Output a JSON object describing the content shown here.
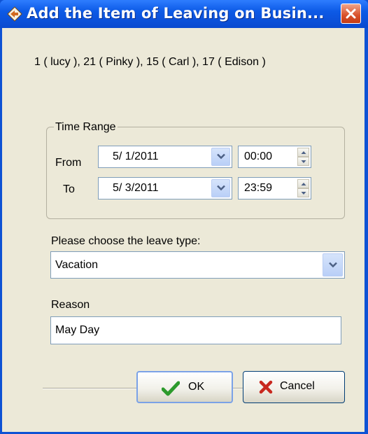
{
  "window": {
    "title": "Add the Item of Leaving on Busin...",
    "icon": "app-arrow-icon",
    "close_icon": "close-icon",
    "accent_color": "#0a49cf"
  },
  "users_text": "1 ( lucy ), 21 ( Pinky ), 15 ( Carl ), 17 ( Edison )",
  "time_range": {
    "title": "Time Range",
    "from_label": "From",
    "to_label": "To",
    "from_date": "5/ 1/2011",
    "from_time": "00:00",
    "to_date": "5/ 3/2011",
    "to_time": "23:59"
  },
  "leave_type": {
    "label": "Please choose the leave type:",
    "value": "Vacation"
  },
  "reason": {
    "label": "Reason",
    "value": "May Day"
  },
  "buttons": {
    "ok_label": "OK",
    "ok_icon": "check-icon",
    "cancel_label": "Cancel",
    "cancel_icon": "x-icon"
  }
}
